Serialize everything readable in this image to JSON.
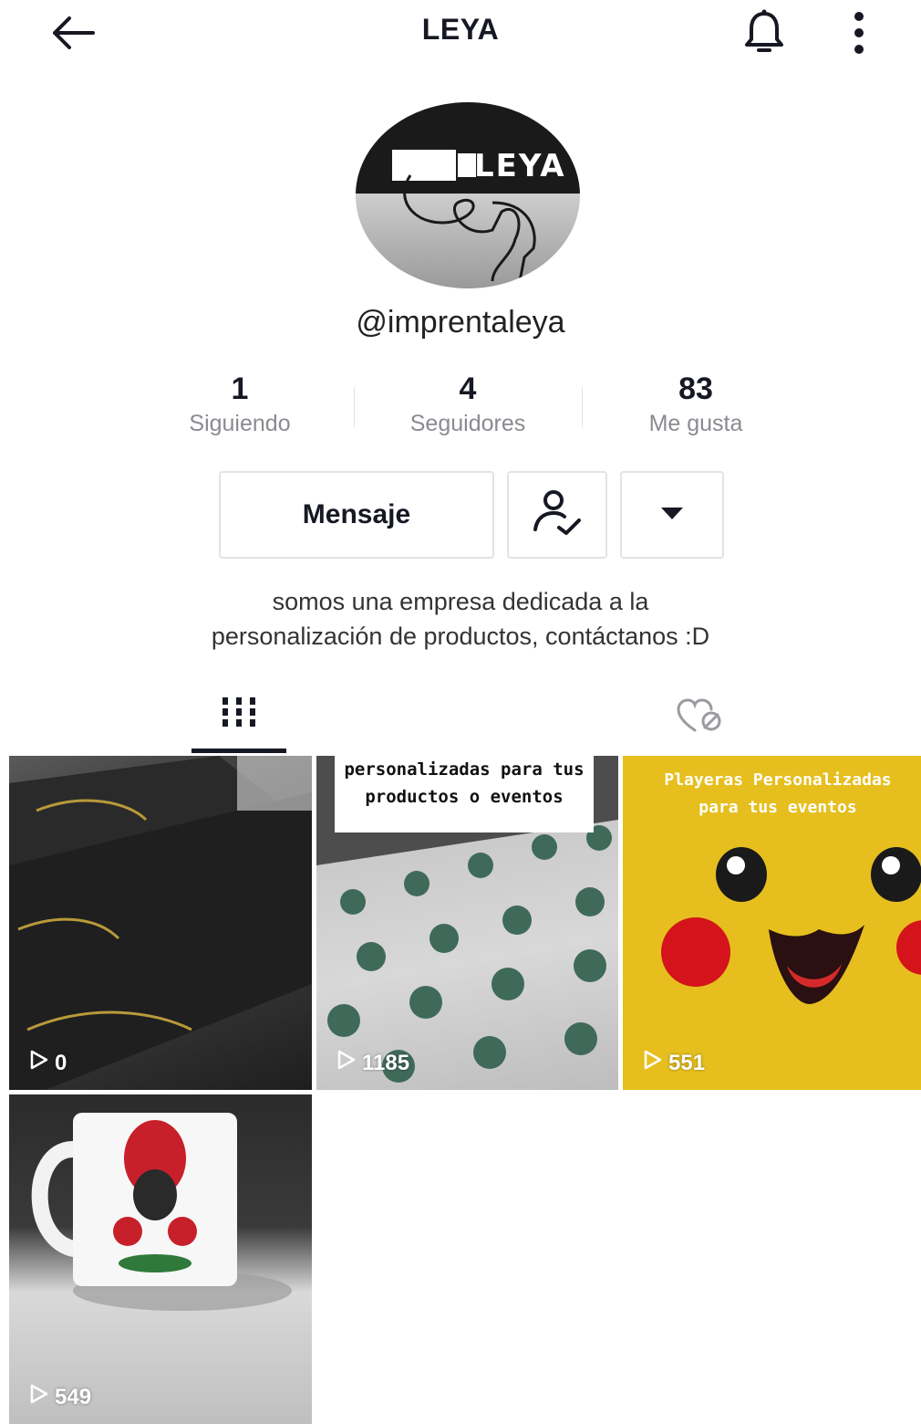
{
  "header": {
    "title": "LEYA",
    "back_icon": "arrow-left-icon",
    "bell_icon": "bell-icon",
    "more_icon": "more-vertical-icon"
  },
  "profile": {
    "avatar_logo_text": "LEYA",
    "username": "@imprentaleya",
    "stats": [
      {
        "value": "1",
        "label": "Siguiendo"
      },
      {
        "value": "4",
        "label": "Seguidores"
      },
      {
        "value": "83",
        "label": "Me gusta"
      }
    ],
    "message_button": "Mensaje",
    "bio_line1": "somos una empresa dedicada a la",
    "bio_line2": "personalización de productos, contáctanos :D"
  },
  "tabs": [
    {
      "icon": "grid-icon",
      "active": true
    },
    {
      "icon": "liked-hidden-icon",
      "active": false
    }
  ],
  "videos": [
    {
      "views": "0",
      "caption": ""
    },
    {
      "views": "1185",
      "caption": "personalizadas para tus productos o eventos"
    },
    {
      "views": "551",
      "caption": "Playeras Personalizadas para tus eventos"
    },
    {
      "views": "549",
      "caption": ""
    }
  ],
  "colors": {
    "text_primary": "#161823",
    "text_secondary": "#8a8b91",
    "border": "#e3e3e4",
    "yellow_tile": "#e9c21f"
  }
}
